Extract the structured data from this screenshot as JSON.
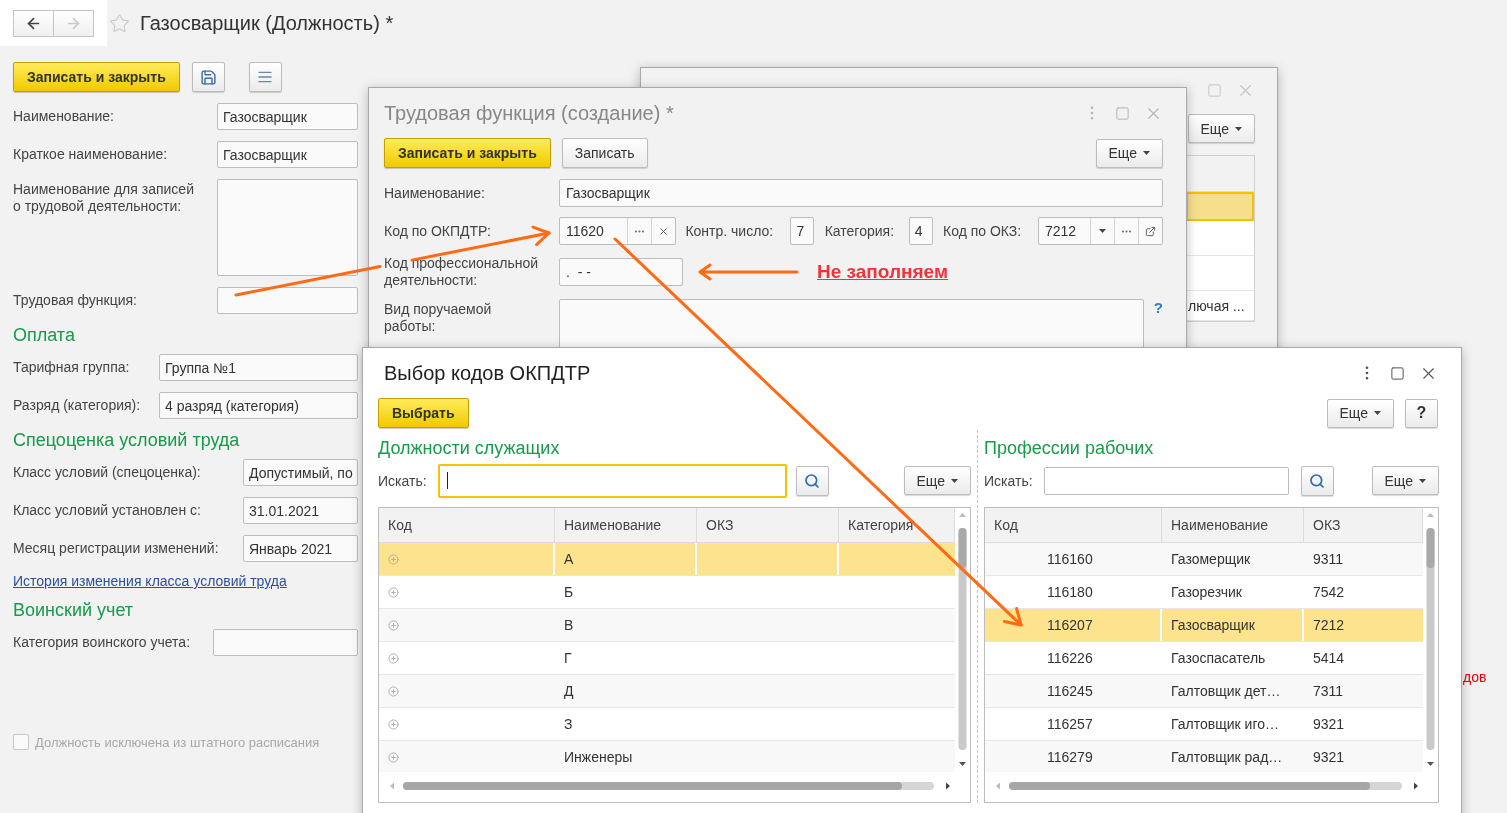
{
  "main_form": {
    "nav": {
      "back": {
        "disabled": false
      },
      "forward": {
        "disabled": true
      }
    },
    "favorite": false,
    "title": "Газосварщик (Должность) *",
    "toolbar": {
      "save_close_button": "Записать и закрыть"
    },
    "groups": [
      {
        "fields": [
          {
            "kind": "input",
            "label": "Наименование:",
            "value": "Газосварщик"
          },
          {
            "kind": "input",
            "label": "Краткое наименование:",
            "value": "Газосварщик"
          },
          {
            "kind": "textarea",
            "label": "Наименование для записей о трудовой деятельности:"
          },
          {
            "kind": "input",
            "label": "Трудовая функция:"
          }
        ]
      },
      {
        "heading": "Оплата",
        "fields": [
          {
            "kind": "input",
            "label": "Тарифная группа:",
            "value": "Группа №1"
          },
          {
            "kind": "input",
            "label": "Разряд (категория):",
            "value": "4 разряд (категория)"
          }
        ]
      },
      {
        "heading": "Спецоценка условий труда",
        "fields": [
          {
            "kind": "input",
            "label": "Класс условий (спецоценка):",
            "value": "Допустимый, по"
          },
          {
            "kind": "input",
            "label": "Класс условий установлен с:",
            "value": "31.01.2021"
          },
          {
            "kind": "input",
            "label": "Месяц регистрации изменений:",
            "value": "Январь 2021"
          }
        ],
        "link": "История изменения класса условий труда"
      },
      {
        "heading": "Воинский учет",
        "fields": [
          {
            "kind": "input",
            "label": "Категория воинского учета:"
          }
        ]
      }
    ],
    "checkbox": {
      "label": "Должность исключена из штатного расписания",
      "checked": false,
      "disabled": true
    },
    "side_note": "дов"
  },
  "back_window": {
    "more_button": "Еще",
    "rows": [
      {
        "selected": true
      },
      {
        "selected": false
      },
      {
        "selected": false
      },
      {
        "selected": false,
        "text": "лючая ..."
      }
    ]
  },
  "labor_function_dialog": {
    "title": "Трудовая функция (создание) *",
    "save_close_button": "Записать и закрыть",
    "save_button": "Записать",
    "more_button": "Еще",
    "name": {
      "label": "Наименование:",
      "value": "Газосварщик"
    },
    "okpdtr": {
      "label": "Код по ОКПДТР:",
      "value": "11620"
    },
    "check_number": {
      "label": "Контр. число:",
      "value": "7"
    },
    "category": {
      "label": "Категория:",
      "value": "4"
    },
    "okz": {
      "label": "Код по ОКЗ:",
      "value": "7212"
    },
    "prof_code": {
      "label": "Код профессиональной деятельности:",
      "value": ".  - -"
    },
    "work_type": {
      "label": "Вид поручаемой работы:",
      "help": "?"
    }
  },
  "okpdtr_dialog": {
    "title": "Выбор кодов ОКПДТР",
    "select_button": "Выбрать",
    "more_button": "Еще",
    "help_button": "?",
    "employees": {
      "heading": "Должности служащих",
      "search_label": "Искать:",
      "search_focused": true,
      "more_button": "Еще",
      "columns": [
        "Код",
        "Наименование",
        "ОКЗ",
        "Категория"
      ],
      "rows": [
        {
          "name": "А",
          "selected": true
        },
        {
          "name": "Б",
          "selected": false
        },
        {
          "name": "В",
          "selected": false
        },
        {
          "name": "Г",
          "selected": false
        },
        {
          "name": "Д",
          "selected": false
        },
        {
          "name": "З",
          "selected": false
        },
        {
          "name": "Инженеры",
          "selected": false
        }
      ]
    },
    "workers": {
      "heading": "Профессии рабочих",
      "search_label": "Искать:",
      "search_focused": false,
      "more_button": "Еще",
      "columns": [
        "Код",
        "Наименование",
        "ОКЗ"
      ],
      "rows": [
        {
          "code": "116160",
          "name": "Газомерщик",
          "okz": "9311",
          "selected": false
        },
        {
          "code": "116180",
          "name": "Газорезчик",
          "okz": "7542",
          "selected": false
        },
        {
          "code": "116207",
          "name": "Газосварщик",
          "okz": "7212",
          "selected": true
        },
        {
          "code": "116226",
          "name": "Газоспасатель",
          "okz": "5414",
          "selected": false
        },
        {
          "code": "116245",
          "name": "Галтовщик дет…",
          "okz": "7311",
          "selected": false
        },
        {
          "code": "116257",
          "name": "Галтовщик иго…",
          "okz": "9321",
          "selected": false
        },
        {
          "code": "116279",
          "name": "Галтовщик рад…",
          "okz": "9321",
          "selected": false
        }
      ]
    }
  },
  "annotation": {
    "note": "Не заполняем"
  }
}
